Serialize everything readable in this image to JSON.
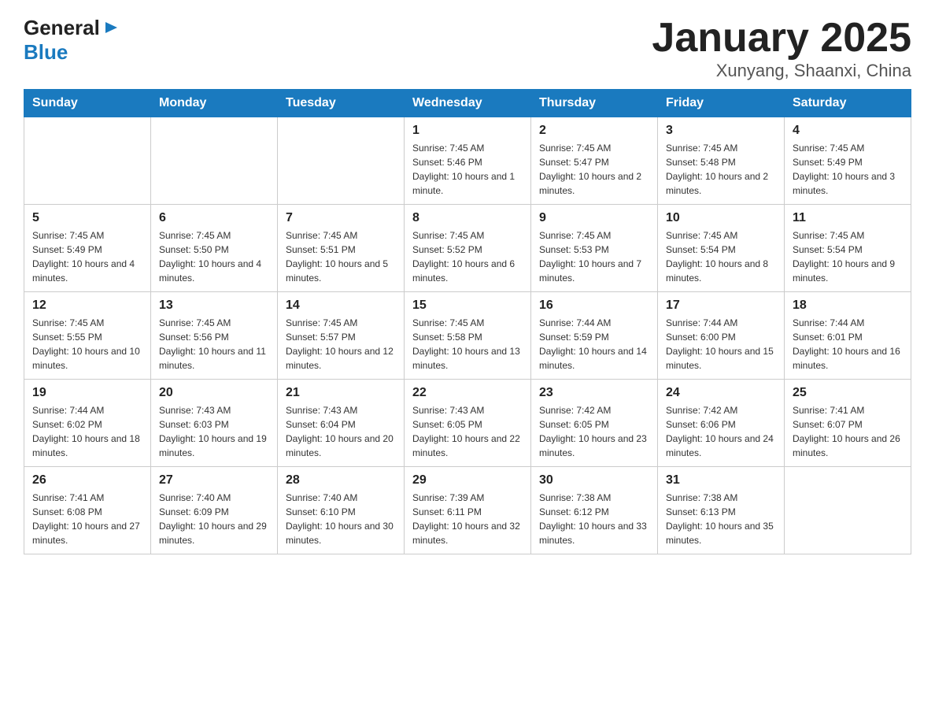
{
  "header": {
    "logo_general": "General",
    "logo_blue": "Blue",
    "month_title": "January 2025",
    "location": "Xunyang, Shaanxi, China"
  },
  "weekdays": [
    "Sunday",
    "Monday",
    "Tuesday",
    "Wednesday",
    "Thursday",
    "Friday",
    "Saturday"
  ],
  "weeks": [
    [
      {
        "day": "",
        "info": ""
      },
      {
        "day": "",
        "info": ""
      },
      {
        "day": "",
        "info": ""
      },
      {
        "day": "1",
        "info": "Sunrise: 7:45 AM\nSunset: 5:46 PM\nDaylight: 10 hours and 1 minute."
      },
      {
        "day": "2",
        "info": "Sunrise: 7:45 AM\nSunset: 5:47 PM\nDaylight: 10 hours and 2 minutes."
      },
      {
        "day": "3",
        "info": "Sunrise: 7:45 AM\nSunset: 5:48 PM\nDaylight: 10 hours and 2 minutes."
      },
      {
        "day": "4",
        "info": "Sunrise: 7:45 AM\nSunset: 5:49 PM\nDaylight: 10 hours and 3 minutes."
      }
    ],
    [
      {
        "day": "5",
        "info": "Sunrise: 7:45 AM\nSunset: 5:49 PM\nDaylight: 10 hours and 4 minutes."
      },
      {
        "day": "6",
        "info": "Sunrise: 7:45 AM\nSunset: 5:50 PM\nDaylight: 10 hours and 4 minutes."
      },
      {
        "day": "7",
        "info": "Sunrise: 7:45 AM\nSunset: 5:51 PM\nDaylight: 10 hours and 5 minutes."
      },
      {
        "day": "8",
        "info": "Sunrise: 7:45 AM\nSunset: 5:52 PM\nDaylight: 10 hours and 6 minutes."
      },
      {
        "day": "9",
        "info": "Sunrise: 7:45 AM\nSunset: 5:53 PM\nDaylight: 10 hours and 7 minutes."
      },
      {
        "day": "10",
        "info": "Sunrise: 7:45 AM\nSunset: 5:54 PM\nDaylight: 10 hours and 8 minutes."
      },
      {
        "day": "11",
        "info": "Sunrise: 7:45 AM\nSunset: 5:54 PM\nDaylight: 10 hours and 9 minutes."
      }
    ],
    [
      {
        "day": "12",
        "info": "Sunrise: 7:45 AM\nSunset: 5:55 PM\nDaylight: 10 hours and 10 minutes."
      },
      {
        "day": "13",
        "info": "Sunrise: 7:45 AM\nSunset: 5:56 PM\nDaylight: 10 hours and 11 minutes."
      },
      {
        "day": "14",
        "info": "Sunrise: 7:45 AM\nSunset: 5:57 PM\nDaylight: 10 hours and 12 minutes."
      },
      {
        "day": "15",
        "info": "Sunrise: 7:45 AM\nSunset: 5:58 PM\nDaylight: 10 hours and 13 minutes."
      },
      {
        "day": "16",
        "info": "Sunrise: 7:44 AM\nSunset: 5:59 PM\nDaylight: 10 hours and 14 minutes."
      },
      {
        "day": "17",
        "info": "Sunrise: 7:44 AM\nSunset: 6:00 PM\nDaylight: 10 hours and 15 minutes."
      },
      {
        "day": "18",
        "info": "Sunrise: 7:44 AM\nSunset: 6:01 PM\nDaylight: 10 hours and 16 minutes."
      }
    ],
    [
      {
        "day": "19",
        "info": "Sunrise: 7:44 AM\nSunset: 6:02 PM\nDaylight: 10 hours and 18 minutes."
      },
      {
        "day": "20",
        "info": "Sunrise: 7:43 AM\nSunset: 6:03 PM\nDaylight: 10 hours and 19 minutes."
      },
      {
        "day": "21",
        "info": "Sunrise: 7:43 AM\nSunset: 6:04 PM\nDaylight: 10 hours and 20 minutes."
      },
      {
        "day": "22",
        "info": "Sunrise: 7:43 AM\nSunset: 6:05 PM\nDaylight: 10 hours and 22 minutes."
      },
      {
        "day": "23",
        "info": "Sunrise: 7:42 AM\nSunset: 6:05 PM\nDaylight: 10 hours and 23 minutes."
      },
      {
        "day": "24",
        "info": "Sunrise: 7:42 AM\nSunset: 6:06 PM\nDaylight: 10 hours and 24 minutes."
      },
      {
        "day": "25",
        "info": "Sunrise: 7:41 AM\nSunset: 6:07 PM\nDaylight: 10 hours and 26 minutes."
      }
    ],
    [
      {
        "day": "26",
        "info": "Sunrise: 7:41 AM\nSunset: 6:08 PM\nDaylight: 10 hours and 27 minutes."
      },
      {
        "day": "27",
        "info": "Sunrise: 7:40 AM\nSunset: 6:09 PM\nDaylight: 10 hours and 29 minutes."
      },
      {
        "day": "28",
        "info": "Sunrise: 7:40 AM\nSunset: 6:10 PM\nDaylight: 10 hours and 30 minutes."
      },
      {
        "day": "29",
        "info": "Sunrise: 7:39 AM\nSunset: 6:11 PM\nDaylight: 10 hours and 32 minutes."
      },
      {
        "day": "30",
        "info": "Sunrise: 7:38 AM\nSunset: 6:12 PM\nDaylight: 10 hours and 33 minutes."
      },
      {
        "day": "31",
        "info": "Sunrise: 7:38 AM\nSunset: 6:13 PM\nDaylight: 10 hours and 35 minutes."
      },
      {
        "day": "",
        "info": ""
      }
    ]
  ]
}
